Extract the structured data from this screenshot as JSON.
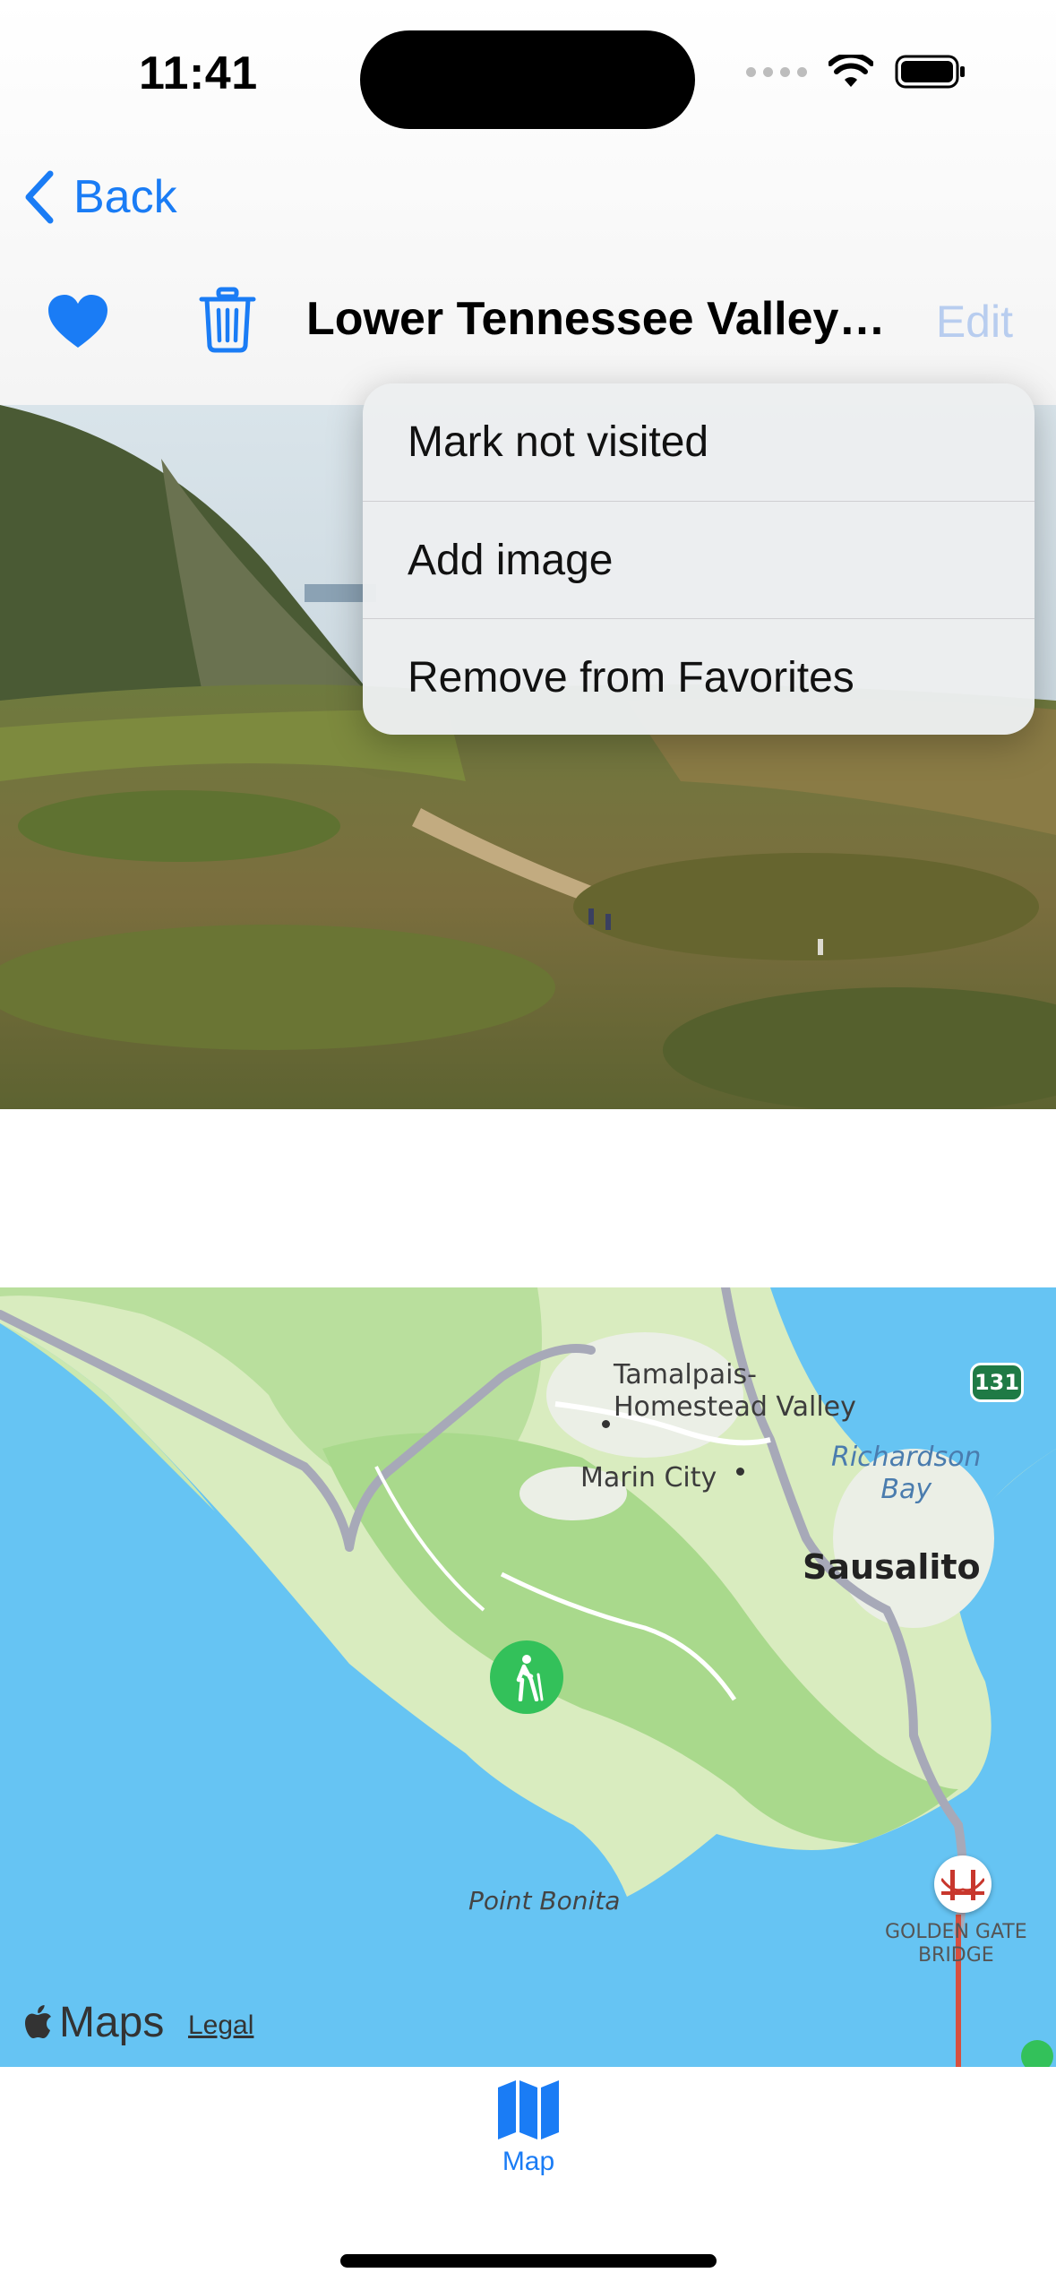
{
  "status_bar": {
    "time": "11:41"
  },
  "nav": {
    "back_label": "Back",
    "title": "Lower Tennessee Valley T...",
    "edit_label": "Edit"
  },
  "menu": {
    "items": [
      {
        "label": "Mark not visited"
      },
      {
        "label": "Add image"
      },
      {
        "label": "Remove from Favorites"
      }
    ]
  },
  "map": {
    "places": {
      "tamalpais": "Tamalpais-\nHomestead Valley",
      "tamalpais_line1": "Tamalpais-",
      "tamalpais_line2": "Homestead Valley",
      "marin_city": "Marin City",
      "richardson_bay_line1": "Richardson",
      "richardson_bay_line2": "Bay",
      "sausalito": "Sausalito",
      "point_bonita": "Point Bonita",
      "golden_gate_line1": "GOLDEN GATE",
      "golden_gate_line2": "BRIDGE",
      "route_shield": "131"
    },
    "attribution": {
      "brand": "Maps",
      "legal": "Legal"
    },
    "colors": {
      "water": "#66c4f3",
      "land": "#d9ecbf",
      "park": "#a9d98c",
      "road": "#a7a9b8",
      "pin": "#33c15a"
    }
  },
  "tabbar": {
    "map_label": "Map"
  },
  "accent_color": "#1a7cf5"
}
